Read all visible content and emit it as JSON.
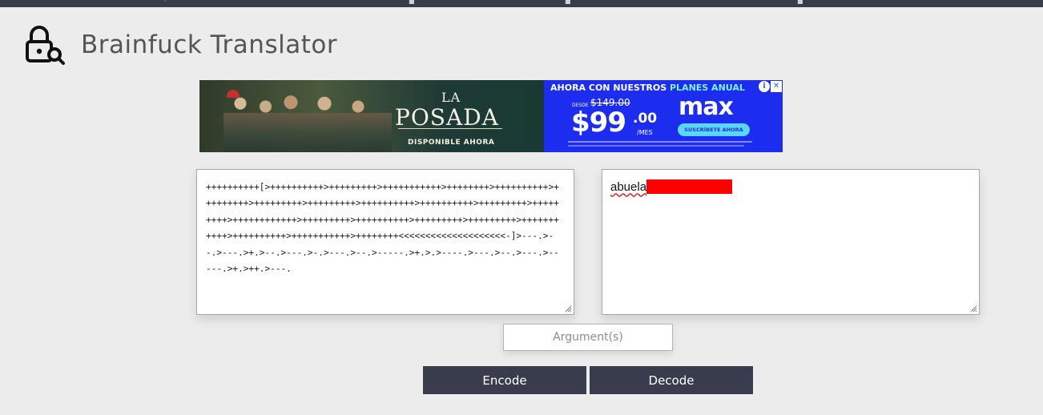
{
  "header": {
    "title": "Brainfuck Translator",
    "icon": "lock-search-icon"
  },
  "ad": {
    "show_small": "LA",
    "show_big": "POSADA",
    "availability": "DISPONIBLE AHORA",
    "promo_prefix": "AHORA CON NUESTROS ",
    "promo_highlight": "PLANES ANUAL",
    "from_label": "DESDE",
    "old_price": "$149.00",
    "price": "$99",
    "price_cents": ".00",
    "period": "/MES",
    "brand": "max",
    "cta": "SUSCRÍBETE AHORA"
  },
  "input": {
    "code": "++++++++++[>++++++++++>+++++++++>+++++++++++>++++++++>++++++++++>+++++++++>+++++++++>+++++++++>++++++++++>++++++++++>+++++++++>+++++++++>++++++++++++>+++++++++>++++++++++>+++++++++>+++++++++>+++++++++++>++++++++++>+++++++++++>++++++++<<<<<<<<<<<<<<<<<<<<-]>---.>--.>---.>+.>--.>---.>-.>---.>--.>-----.>+.>.>----.>---.>--.>---.>-----.>+.>++.>---."
  },
  "output": {
    "visible_text": "abuela"
  },
  "argument": {
    "placeholder": "Argument(s)",
    "value": ""
  },
  "buttons": {
    "encode_label": "Encode",
    "decode_label": "Decode"
  },
  "colors": {
    "page_background": "#ececec",
    "button_background": "#393c4d",
    "ad_blue": "#1d2df0",
    "redaction": "#ff0000"
  }
}
